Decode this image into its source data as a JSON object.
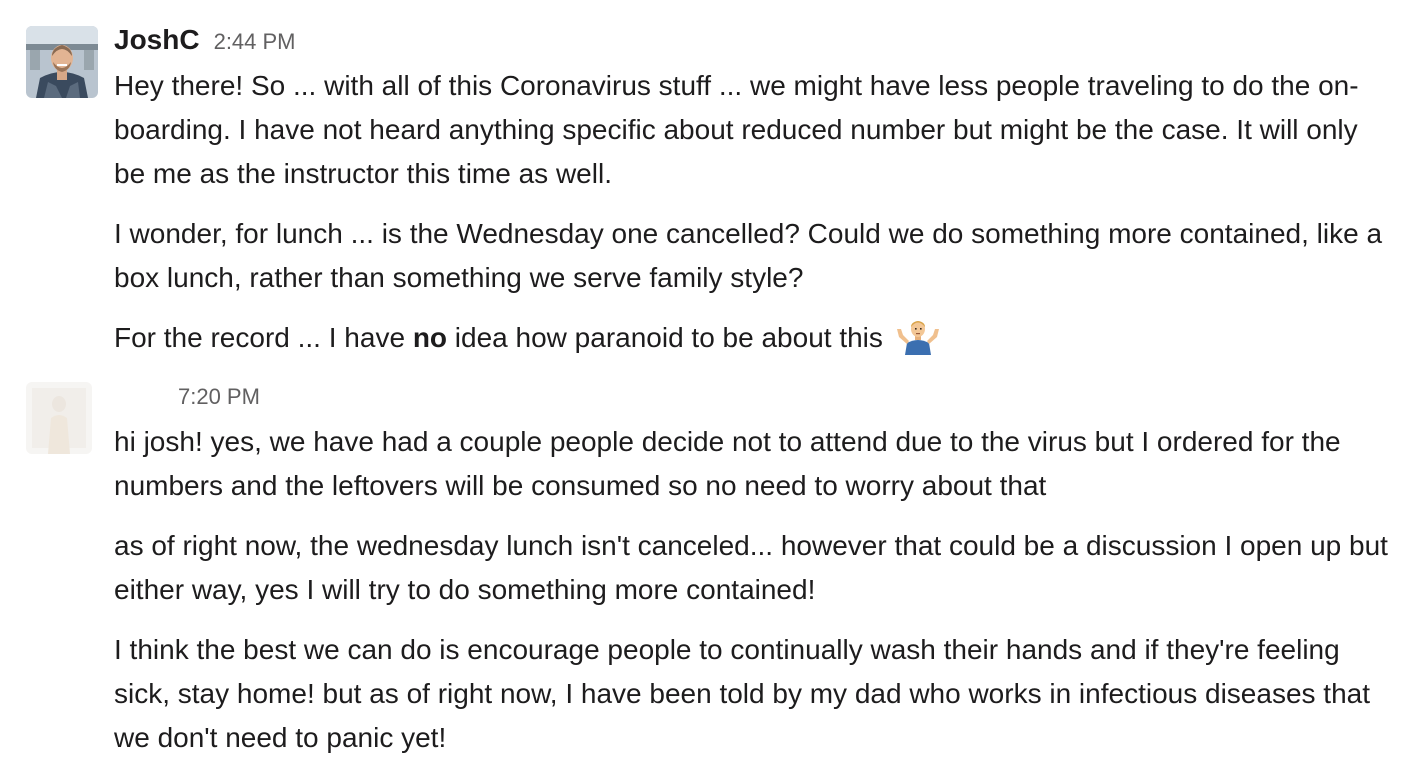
{
  "messages": [
    {
      "username": "JoshC",
      "timestamp": "2:44 PM",
      "avatar": "avatar-joshc",
      "paragraphs": [
        "Hey there! So ... with all of this Coronavirus stuff ... we might have less people traveling to do the on-boarding. I have not heard anything specific about reduced number but might be the case. It will only be me as the instructor this time as well.",
        "I wonder, for lunch ... is the Wednesday one cancelled? Could we do something more contained, like a box lunch, rather than something we serve family style?"
      ],
      "last_paragraph": {
        "before": "For the record ... I have ",
        "bold": "no",
        "after": " idea how paranoid to be about this",
        "emoji": "person-shrugging-icon"
      }
    },
    {
      "username": "",
      "timestamp": "7:20 PM",
      "avatar": "avatar-faded",
      "paragraphs": [
        "hi josh! yes, we have had a couple people decide not to attend due to the virus but I ordered for the numbers and the leftovers will be consumed so no need to worry about that",
        "as of right now, the wednesday lunch isn't canceled... however that could be a discussion I open up but either way, yes I will try to do something more contained!",
        "I think the best we can do is encourage people to continually wash their hands and if they're feeling sick, stay home! but as of right now, I have been told by my dad who works in infectious diseases that we don't need to panic yet!"
      ]
    }
  ],
  "colors": {
    "text": "#1d1c1d",
    "timestamp": "#616061"
  }
}
